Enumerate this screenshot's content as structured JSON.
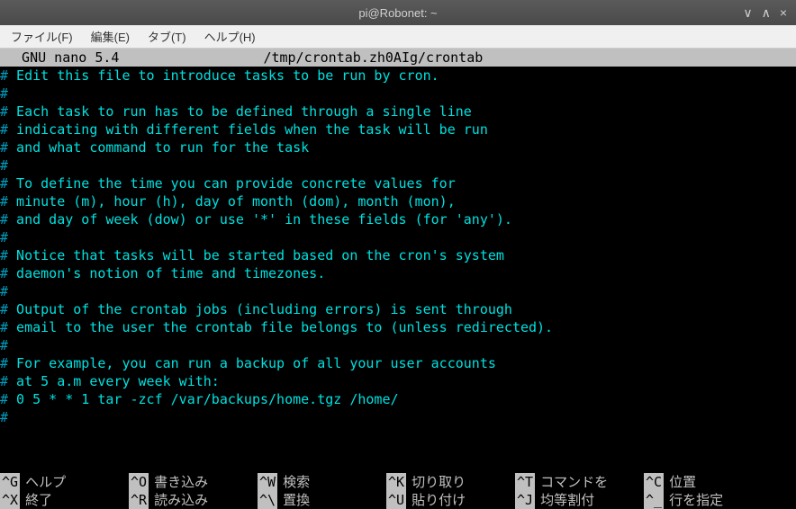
{
  "titlebar": {
    "title": "pi@Robonet: ~"
  },
  "menubar": {
    "file": "ファイル(F)",
    "edit": "編集(E)",
    "tabs": "タブ(T)",
    "help": "ヘルプ(H)"
  },
  "nano": {
    "header_left": "  GNU nano 5.4",
    "header_path": "/tmp/crontab.zh0AIg/crontab",
    "lines": [
      "# Edit this file to introduce tasks to be run by cron.",
      "#",
      "# Each task to run has to be defined through a single line",
      "# indicating with different fields when the task will be run",
      "# and what command to run for the task",
      "#",
      "# To define the time you can provide concrete values for",
      "# minute (m), hour (h), day of month (dom), month (mon),",
      "# and day of week (dow) or use '*' in these fields (for 'any').",
      "#",
      "# Notice that tasks will be started based on the cron's system",
      "# daemon's notion of time and timezones.",
      "#",
      "# Output of the crontab jobs (including errors) is sent through",
      "# email to the user the crontab file belongs to (unless redirected).",
      "#",
      "# For example, you can run a backup of all your user accounts",
      "# at 5 a.m every week with:",
      "# 0 5 * * 1 tar -zcf /var/backups/home.tgz /home/",
      "#"
    ],
    "footer": {
      "row1": [
        {
          "key": "^G",
          "label": "ヘルプ"
        },
        {
          "key": "^O",
          "label": "書き込み"
        },
        {
          "key": "^W",
          "label": "検索"
        },
        {
          "key": "^K",
          "label": "切り取り"
        },
        {
          "key": "^T",
          "label": "コマンドを"
        },
        {
          "key": "^C",
          "label": "位置"
        }
      ],
      "row2": [
        {
          "key": "^X",
          "label": "終了"
        },
        {
          "key": "^R",
          "label": "読み込み"
        },
        {
          "key": "^\\",
          "label": "置換"
        },
        {
          "key": "^U",
          "label": "貼り付け"
        },
        {
          "key": "^J",
          "label": "均等割付"
        },
        {
          "key": "^_",
          "label": "行を指定"
        }
      ]
    }
  }
}
